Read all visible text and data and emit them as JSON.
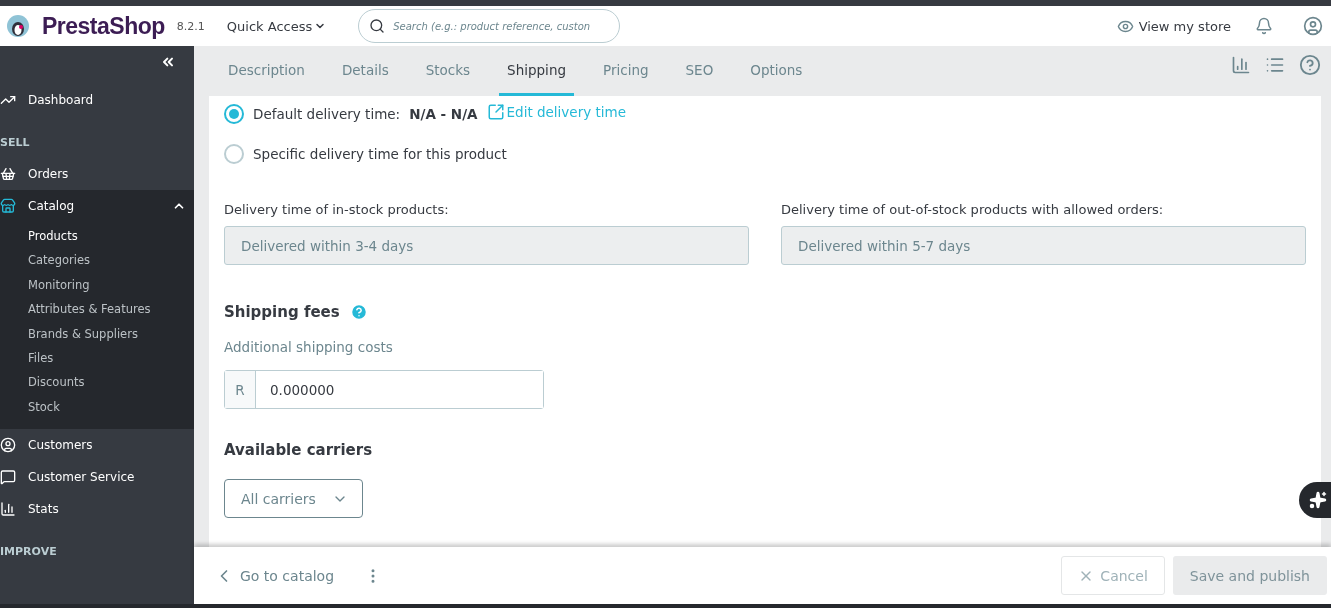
{
  "header": {
    "brand": "PrestaShop",
    "version": "8.2.1",
    "quick_access": "Quick Access",
    "search": {
      "placeholder": "Search (e.g.: product reference, custon"
    },
    "view_store": "View my store"
  },
  "sidebar": {
    "items": [
      {
        "kind": "link",
        "label": "Dashboard"
      },
      {
        "kind": "section",
        "label": "SELL"
      },
      {
        "kind": "link",
        "label": "Orders"
      },
      {
        "kind": "link",
        "label": "Catalog",
        "expanded": true,
        "children": [
          {
            "label": "Products",
            "selected": true
          },
          {
            "label": "Categories",
            "selected": false
          },
          {
            "label": "Monitoring",
            "selected": false
          },
          {
            "label": "Attributes & Features",
            "selected": false
          },
          {
            "label": "Brands & Suppliers",
            "selected": false
          },
          {
            "label": "Files",
            "selected": false
          },
          {
            "label": "Discounts",
            "selected": false
          },
          {
            "label": "Stock",
            "selected": false
          }
        ]
      },
      {
        "kind": "link",
        "label": "Customers"
      },
      {
        "kind": "link",
        "label": "Customer Service"
      },
      {
        "kind": "link",
        "label": "Stats"
      },
      {
        "kind": "section",
        "label": "IMPROVE"
      }
    ]
  },
  "tabs": [
    {
      "label": "Description",
      "selected": false
    },
    {
      "label": "Details",
      "selected": false
    },
    {
      "label": "Stocks",
      "selected": false
    },
    {
      "label": "Shipping",
      "selected": true
    },
    {
      "label": "Pricing",
      "selected": false
    },
    {
      "label": "SEO",
      "selected": false
    },
    {
      "label": "Options",
      "selected": false
    }
  ],
  "delivery": {
    "options": [
      {
        "label": "Default delivery time:",
        "value": "N/A - N/A",
        "link": "Edit delivery time",
        "selected": true
      },
      {
        "label": "Specific delivery time for this product",
        "selected": false
      }
    ],
    "fields": [
      {
        "label": "Delivery time of in-stock products:",
        "value": "Delivered within 3-4 days",
        "disabled": true
      },
      {
        "label": "Delivery time of out-of-stock products with allowed orders:",
        "value": "Delivered within 5-7 days",
        "disabled": true
      }
    ]
  },
  "shipping_fees": {
    "title": "Shipping fees",
    "label": "Additional shipping costs",
    "prefix": "R",
    "value": "0.000000"
  },
  "carriers": {
    "title": "Available carriers",
    "select": "All carriers"
  },
  "footer": {
    "back": "Go to catalog",
    "cancel": {
      "label": "Cancel",
      "disabled": true
    },
    "save": {
      "label": "Save and publish",
      "disabled": true
    }
  }
}
